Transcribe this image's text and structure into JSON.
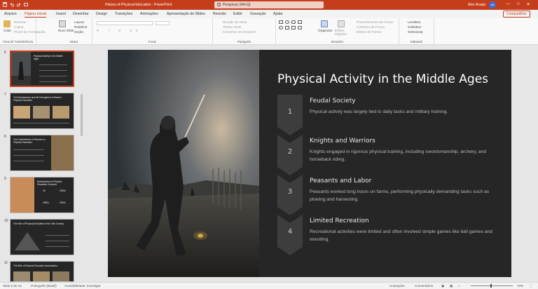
{
  "titlebar": {
    "doc_title": "History-of-Physical-Education  -  PowerPoint",
    "search_placeholder": "Pesquisar (Alt+Q)",
    "user": "Alex Araujo",
    "avatar": "AA"
  },
  "menu": {
    "tabs": [
      "Arquivo",
      "Página Inicial",
      "Inserir",
      "Desenhar",
      "Design",
      "Transições",
      "Animações",
      "Apresentação de Slides",
      "Revisão",
      "Exibir",
      "Gravação",
      "Ajuda"
    ],
    "active": "Página Inicial",
    "share": "Compartilhar"
  },
  "ribbon": {
    "clipboard": {
      "paste": "Colar",
      "cut": "Recortar",
      "copy": "Copiar",
      "format_painter": "Pincel de Formatação",
      "label": "Área de Transferência"
    },
    "slides": {
      "new_slide": "Novo Slide",
      "layout": "Layout",
      "reset": "Redefinir",
      "section": "Seção",
      "label": "Slides"
    },
    "font": {
      "label": "Fonte"
    },
    "paragraph": {
      "text_direction": "Direção do Texto",
      "align_text": "Alinhar Texto",
      "convert_smartart": "Converter em SmartArt",
      "label": "Parágrafo"
    },
    "drawing": {
      "arrange": "Organizar",
      "quick_styles": "Estilos Rápidos",
      "shape_fill": "Preenchimento da Forma",
      "shape_outline": "Contorno da Forma",
      "shape_effects": "Efeitos de Forma",
      "label": "Desenho"
    },
    "editing": {
      "find": "Localizar",
      "replace": "Substituir",
      "select": "Selecionar",
      "label": "Editando"
    }
  },
  "thumbnails": [
    {
      "num": "6",
      "title": "Physical Activity in the Middle Ages",
      "selected": true
    },
    {
      "num": "7",
      "title": "The Renaissance and the Emergence of Modern Physical Education",
      "selected": false
    },
    {
      "num": "8",
      "title": "The Contributions of Pioneers in Physical Education",
      "selected": false
    },
    {
      "num": "9",
      "title": "Development of Physical Education Curricula",
      "selected": false,
      "stats": [
        "18",
        "1900s",
        "1960s",
        "2000s"
      ]
    },
    {
      "num": "10",
      "title": "The Role of Physical Education in the 19th Century",
      "selected": false
    },
    {
      "num": "11",
      "title": "The Birth of Physical Education Associations",
      "selected": false
    }
  ],
  "slide": {
    "title": "Physical Activity in the Middle Ages",
    "items": [
      {
        "num": "1",
        "title": "Feudal Society",
        "desc": "Physical activity was largely tied to daily tasks and military training."
      },
      {
        "num": "2",
        "title": "Knights and Warriors",
        "desc": "Knights engaged in rigorous physical training, including swordsmanship, archery, and horseback riding."
      },
      {
        "num": "3",
        "title": "Peasants and Labor",
        "desc": "Peasants worked long hours on farms, performing physically demanding tasks such as plowing and harvesting."
      },
      {
        "num": "4",
        "title": "Limited Recreation",
        "desc": "Recreational activities were limited and often involved simple games like ball games and wrestling."
      }
    ]
  },
  "statusbar": {
    "slide_count": "Slide 6 de 24",
    "language": "Português (Brasil)",
    "accessibility": "Acessibilidade: investigar",
    "notes": "Anotações",
    "comments": "Comentários",
    "zoom": "73%"
  },
  "colors": {
    "accent": "#c43e1c",
    "slide_bg": "#262626",
    "chevron": "#3d3d3d"
  }
}
